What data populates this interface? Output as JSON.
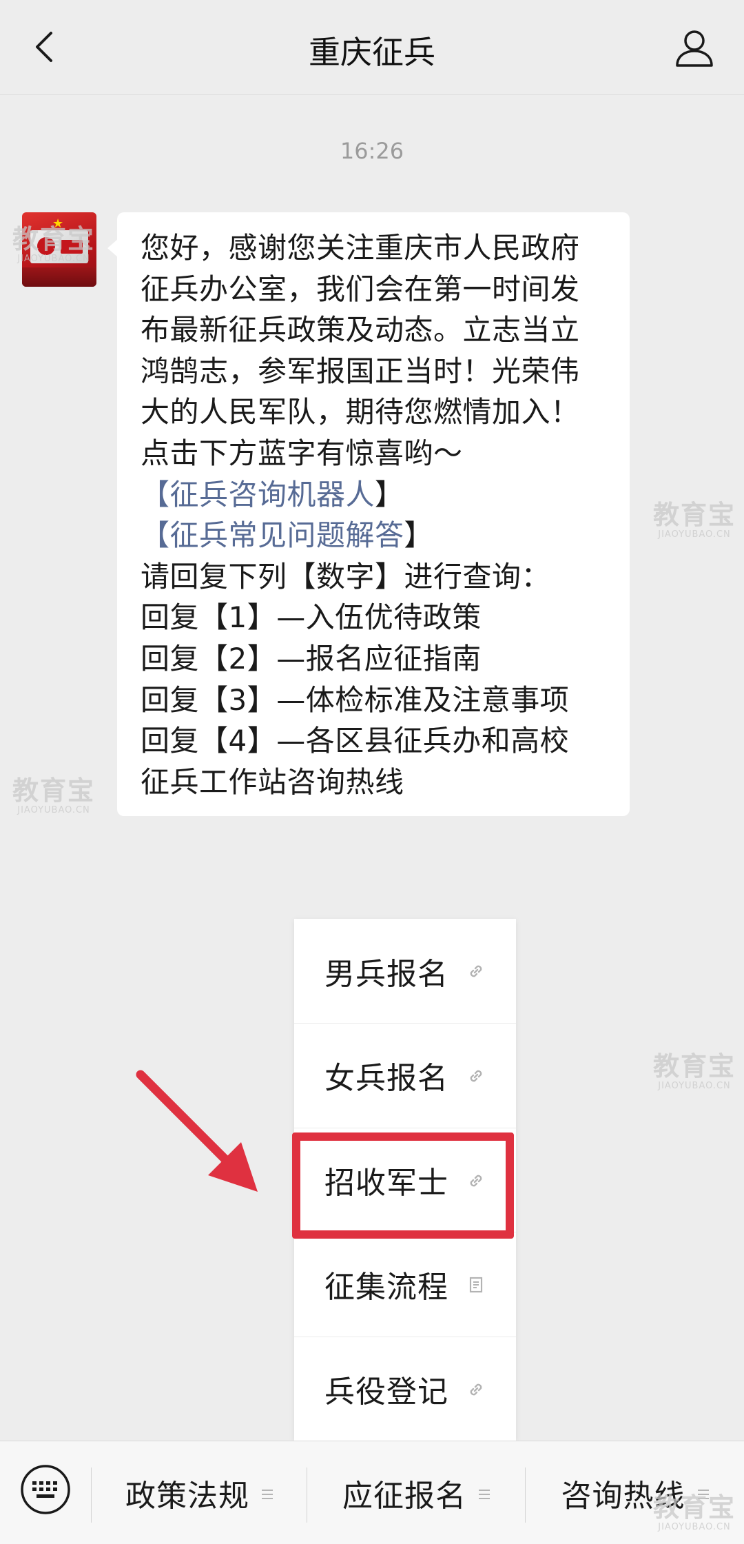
{
  "header": {
    "title": "重庆征兵"
  },
  "chat": {
    "timestamp": "16:26",
    "message": {
      "line1": "您好，感谢您关注重庆市人民政府",
      "line2": "征兵办公室，我们会在第一时间发",
      "line3": "布最新征兵政策及动态。立志当立",
      "line4": "鸿鹄志，参军报国正当时！光荣伟",
      "line5": "大的人民军队，期待您燃情加入！",
      "line6": "点击下方蓝字有惊喜哟～",
      "link1_open": "【",
      "link1_text": "征兵咨询机器人",
      "link1_close": "】",
      "link2_open": "【",
      "link2_text": "征兵常见问题解答",
      "link2_close": "】",
      "line9": "请回复下列【数字】进行查询：",
      "line10": "回复【1】—入伍优待政策",
      "line11": "回复【2】—报名应征指南",
      "line12": "回复【3】—体检标准及注意事项",
      "line13": "回复【4】—各区县征兵办和高校",
      "line14": "征兵工作站咨询热线"
    }
  },
  "popup_menu": {
    "items": [
      {
        "label": "男兵报名",
        "icon": "link-icon"
      },
      {
        "label": "女兵报名",
        "icon": "link-icon"
      },
      {
        "label": "招收军士",
        "icon": "link-icon",
        "highlighted": true
      },
      {
        "label": "征集流程",
        "icon": "article-icon"
      },
      {
        "label": "兵役登记",
        "icon": "link-icon"
      }
    ]
  },
  "menu_bar": {
    "tabs": [
      {
        "label": "政策法规"
      },
      {
        "label": "应征报名"
      },
      {
        "label": "咨询热线"
      }
    ]
  },
  "watermark": {
    "main": "教育宝",
    "sub": "JIAOYUBAO.CN"
  },
  "colors": {
    "background": "#ededed",
    "bubble": "#ffffff",
    "link": "#576b95",
    "highlight": "#df3140"
  }
}
